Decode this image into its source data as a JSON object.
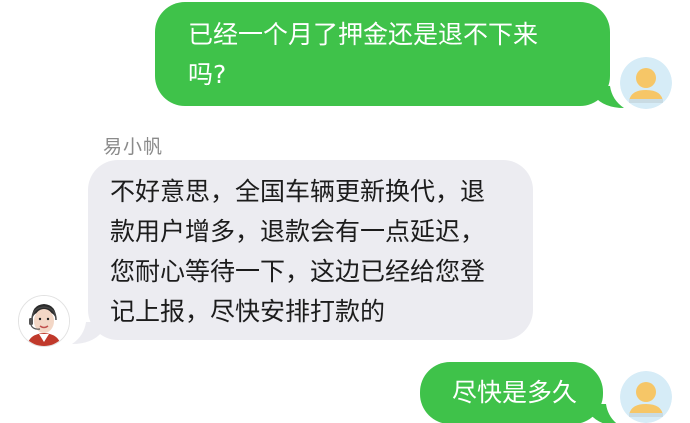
{
  "messages": [
    {
      "direction": "outgoing",
      "lines": [
        "已经一个月了押金还是退不下来",
        "吗?"
      ]
    },
    {
      "direction": "incoming",
      "sender": "易小帆",
      "lines": [
        "不好意思，全国车辆更新换代，退",
        "款用户增多，退款会有一点延迟，",
        "您耐心等待一下，这边已经给您登",
        "记上报，尽快安排打款的"
      ]
    },
    {
      "direction": "outgoing",
      "lines": [
        "尽快是多久"
      ]
    }
  ],
  "colors": {
    "outgoing_bubble": "#3fc24a",
    "incoming_bubble": "#ececf1",
    "outgoing_text": "#ffffff",
    "incoming_text": "#1c1c1c",
    "sender_name": "#8a8a8a",
    "user_avatar_bg": "#d6ecf7",
    "user_avatar_figure": "#f6c667"
  },
  "icons": {
    "user_avatar": "user-silhouette-icon",
    "agent_avatar": "customer-service-agent-photo"
  }
}
